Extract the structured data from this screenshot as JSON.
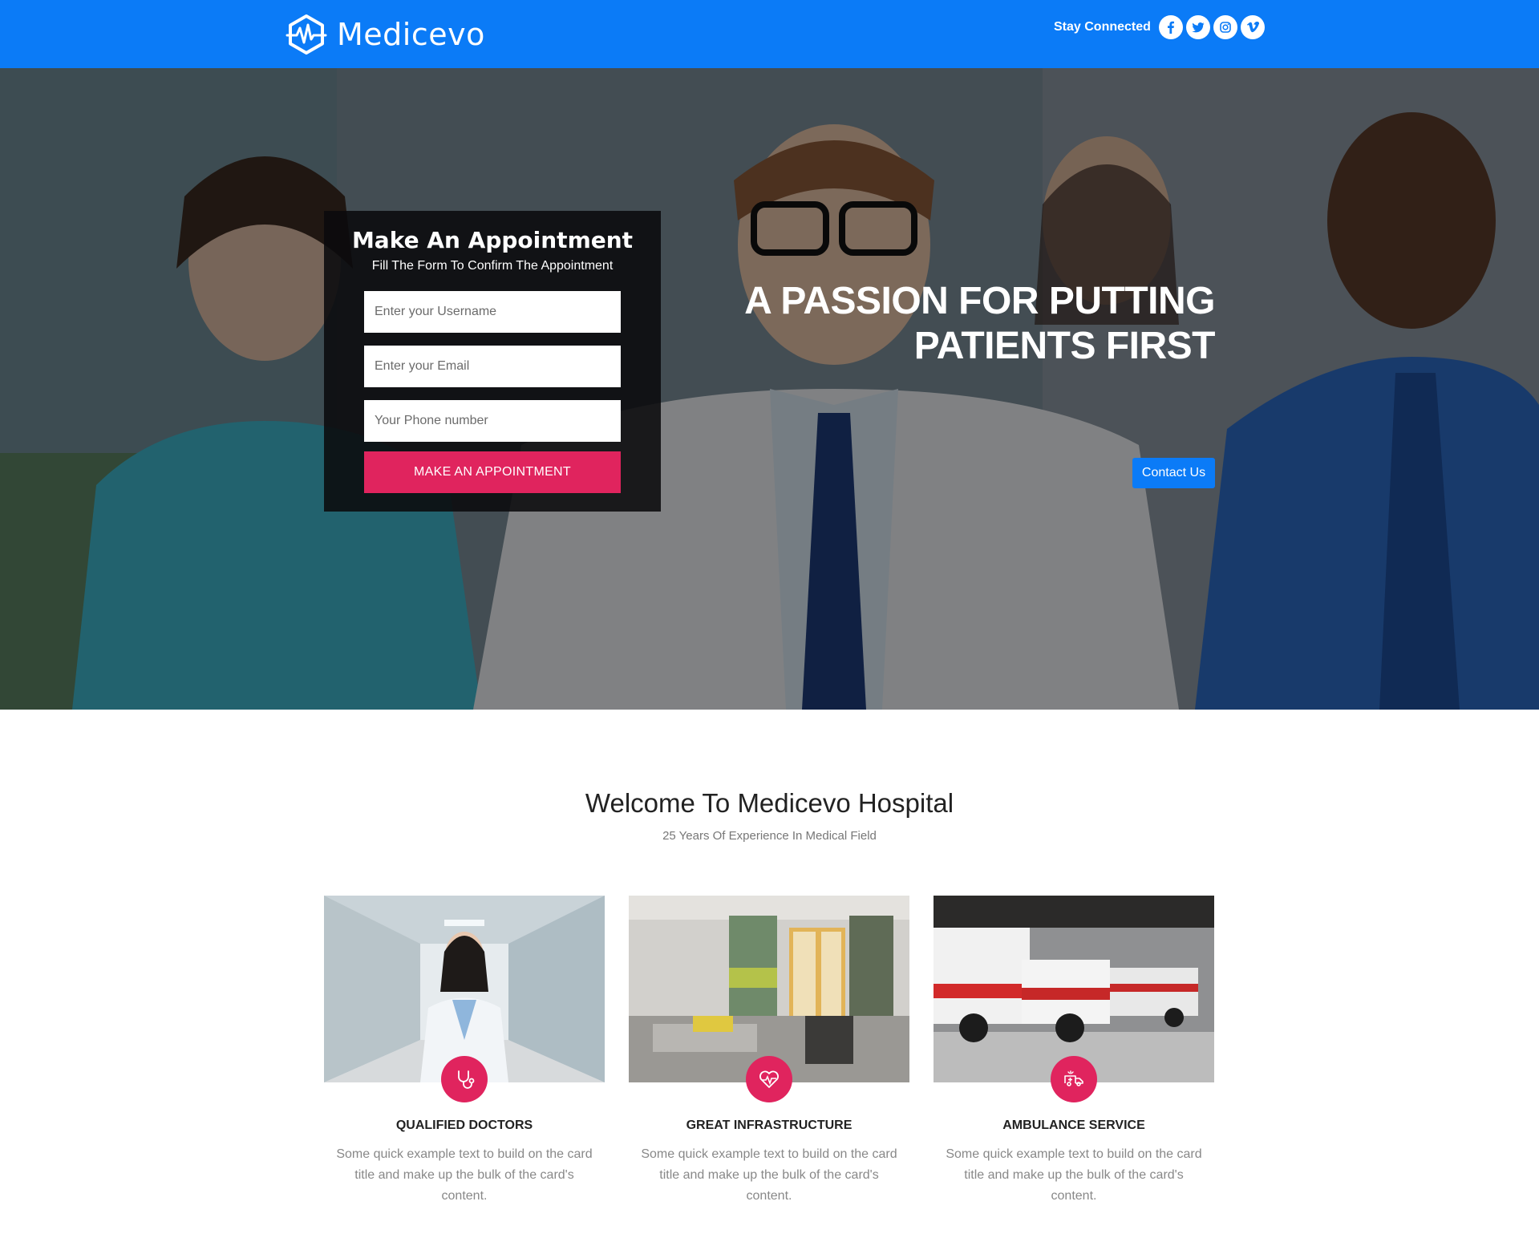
{
  "brand": {
    "name": "Medicevo"
  },
  "header": {
    "social_label": "Stay Connected",
    "social_icons": [
      "facebook-icon",
      "twitter-icon",
      "instagram-icon",
      "vimeo-icon"
    ]
  },
  "appointment": {
    "title": "Make An Appointment",
    "subtitle": "Fill The Form To Confirm The Appointment",
    "username_placeholder": "Enter your Username",
    "email_placeholder": "Enter your Email",
    "phone_placeholder": "Your Phone number",
    "submit_label": "MAKE AN APPOINTMENT"
  },
  "hero": {
    "headline_line1": "A PASSION FOR PUTTING",
    "headline_line2": "PATIENTS FIRST",
    "cta_label": "Contact Us"
  },
  "welcome": {
    "title": "Welcome To Medicevo Hospital",
    "subtitle": "25 Years Of Experience In Medical Field"
  },
  "cards": [
    {
      "title": "QUALIFIED DOCTORS",
      "text": "Some quick example text to build on the card title and make up the bulk of the card's content.",
      "icon": "stethoscope-icon"
    },
    {
      "title": "GREAT INFRASTRUCTURE",
      "text": "Some quick example text to build on the card title and make up the bulk of the card's content.",
      "icon": "heartbeat-icon"
    },
    {
      "title": "AMBULANCE SERVICE",
      "text": "Some quick example text to build on the card title and make up the bulk of the card's content.",
      "icon": "ambulance-icon"
    }
  ],
  "colors": {
    "primary": "#0b7bf7",
    "accent": "#e0245e"
  }
}
